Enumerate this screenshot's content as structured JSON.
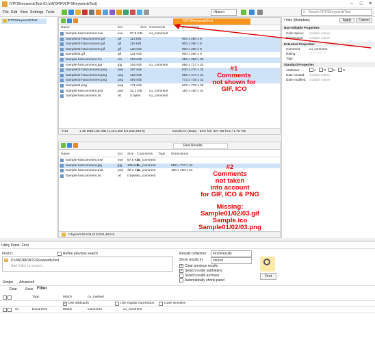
{
  "window": {
    "title": "NTFSKeywordsTest (D:\\zWORK\\NTFSKeywordsTest)"
  },
  "menu": [
    "File",
    "Edit",
    "View",
    "Settings",
    "Tools"
  ],
  "toolbar": {
    "view_dropdown": "<None>",
    "search_placeholder": "Search NTFSKeywordsTest"
  },
  "tree": {
    "root": "NTFSKeywordsTest"
  },
  "top_pane": {
    "tab": "NTFSKeywordsTest",
    "columns": [
      "Name",
      "Ext",
      "Size",
      "Comments",
      "Dimensions"
    ],
    "rows": [
      {
        "name": "Sample-hascomment.exe",
        "ext": "exe",
        "size": "87.5 KiB",
        "comment": "cu_comment",
        "dim": "",
        "sel": false
      },
      {
        "name": "Sample01-hascomment.gif",
        "ext": "gif",
        "size": "113 KiB",
        "comment": "",
        "dim": "900 x 280 x 8",
        "sel": true
      },
      {
        "name": "Sample02-hascomment.gif",
        "ext": "gif",
        "size": "115 KiB",
        "comment": "",
        "dim": "900 x 280 x 8",
        "sel": true
      },
      {
        "name": "Sample03-hascomment.gif",
        "ext": "gif",
        "size": "120 KiB",
        "comment": "",
        "dim": "900 x 280 x 8",
        "sel": true
      },
      {
        "name": "Sample04.gif",
        "ext": "gif",
        "size": "141 KiB",
        "comment": "",
        "dim": "900 x 280 x 8",
        "sel": false
      },
      {
        "name": "Sample-hascomment.ico",
        "ext": "ico",
        "size": "103 KiB",
        "comment": "",
        "dim": "256 x 256 x 32",
        "sel": true
      },
      {
        "name": "Sample-hascomment.jpg",
        "ext": "jpg",
        "size": "106 KiB",
        "comment": "cu_comment",
        "dim": "596 x 717 x 24",
        "sel": false
      },
      {
        "name": "Sample01-hascomment.png",
        "ext": "png",
        "size": "297 KiB",
        "comment": "",
        "dim": "530 x 270 x 32",
        "sel": true
      },
      {
        "name": "Sample02-hascomment.png",
        "ext": "png",
        "size": "183 KiB",
        "comment": "",
        "dim": "592 x 474 x 24",
        "sel": true
      },
      {
        "name": "Sample03-hascomment.png",
        "ext": "png",
        "size": "455 KiB",
        "comment": "",
        "dim": "772 x 716 x 32",
        "sel": true
      },
      {
        "name": "Sample04.png",
        "ext": "png",
        "size": "171 KiB",
        "comment": "",
        "dim": "632 x 778 x 32",
        "sel": false
      },
      {
        "name": "Sample-hascomment.psd",
        "ext": "psd",
        "size": "32.1 KiB",
        "comment": "cu_comment",
        "dim": "160 x 160 x 24",
        "sel": false
      },
      {
        "name": "Sample-hascomment.txt",
        "ext": "txt",
        "size": "0 bytes",
        "comment": "cu_comment",
        "dim": "",
        "sel": false
      }
    ],
    "status_left": "7/13",
    "status_mid": "1.35 MiB/1.85 MiB (1,424,360 b/1,945,499 b)",
    "status_right": "Details  D: (Data) - 82% full, 327 GB free / 1.76 TiB"
  },
  "bottom_pane": {
    "tab": "Find Results",
    "columns": [
      "Name",
      "Ext",
      "Size",
      "Comments",
      "Tags",
      "Dimensions"
    ],
    "rows": [
      {
        "name": "Sample-hascomment.exe",
        "ext": "exe",
        "size": "87.5 KiB",
        "comment": "cu_comment",
        "dim": "",
        "sel": false
      },
      {
        "name": "Sample-hascomment.jpg",
        "ext": "jpg",
        "size": "106 KiB",
        "comment": "cu_comment",
        "dim": "596 x 717 x 24",
        "sel": true
      },
      {
        "name": "Sample-hascomment.psd",
        "ext": "psd",
        "size": "32.1 KiB",
        "comment": "cu_comment",
        "dim": "160 x 160 x 24",
        "sel": false
      },
      {
        "name": "Sample-hascomment.txt",
        "ext": "txt",
        "size": "0 bytes",
        "comment": "cu_comment",
        "dim": "",
        "sel": false
      }
    ],
    "status_mid": "0 bytes/226 KiB (0 b/231,453 b)"
  },
  "meta": {
    "header": "7 files (Metadata)",
    "apply": "Apply",
    "cancel": "Cancel",
    "sections": [
      {
        "title": "Non-editable Properties",
        "rows": [
          [
            "Color space:",
            "multiple values"
          ],
          [
            "Dimensions:",
            "multiple values"
          ]
        ]
      },
      {
        "title": "Extended Properties",
        "rows": [
          [
            "Comment:",
            "cu_comment"
          ],
          [
            "Rating:",
            ""
          ],
          [
            "Tags:",
            ""
          ]
        ]
      },
      {
        "title": "Standard Properties",
        "rows": [
          [
            "Attributes:",
            ""
          ],
          [
            "Date created:",
            "multiple values"
          ],
          [
            "Date modified:",
            "multiple values"
          ]
        ]
      }
    ],
    "attr_letters": [
      "A",
      "R",
      "H",
      "S"
    ]
  },
  "annotations": {
    "one": [
      "#1",
      "Comments",
      "not shown for",
      "GIF, ICO"
    ],
    "two": [
      "#2",
      "Comments",
      "not taken",
      "into account",
      "for GIF, ICO & PNG",
      "",
      "Missing:",
      "Sample01/02/03.gif",
      "Sample.ico",
      "Sample01/02/03.png"
    ]
  },
  "util": {
    "title": "Utility Panel:",
    "mode": "Find",
    "find_in": "Find in:",
    "path": "D:\\zWORK\\NTFSKeywordsTest",
    "add_folder": "Add folder to search...",
    "refine": "Refine previous search",
    "results_collection_label": "Results collection:",
    "results_collection": "Find Results",
    "show_results_label": "Show results in:",
    "show_results": "source",
    "checks": [
      {
        "label": "Clear previous results",
        "on": true
      },
      {
        "label": "Search inside subfolders",
        "on": true
      },
      {
        "label": "Search inside archives",
        "on": false
      },
      {
        "label": "Automatically shrink panel",
        "on": false
      }
    ],
    "find_button": "Find",
    "tabs": [
      "Simple",
      "Advanced"
    ],
    "clear": "Clear",
    "save": "Save",
    "filter": "Filter",
    "grid": [
      {
        "c1": "Tags",
        "c2": "Match",
        "c3": "cu_marked"
      },
      {
        "c1": "",
        "c2": "Use wildcards",
        "c3": "Use regular expression",
        "c4": "Case sensitive"
      },
      {
        "c0": "Or",
        "c1": "Document",
        "c2": "Match",
        "c3": "Comment",
        "c4": "cu_comment"
      }
    ]
  }
}
